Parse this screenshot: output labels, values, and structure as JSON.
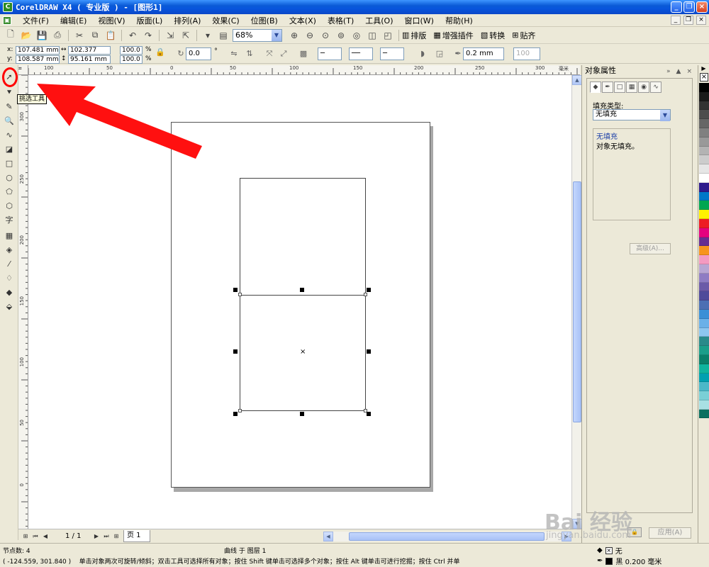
{
  "window": {
    "title": "CorelDRAW X4 ( 专业版 ) - [图形1]",
    "app_icon": "coreldraw-icon"
  },
  "menu": {
    "items": [
      "文件(F)",
      "编辑(E)",
      "视图(V)",
      "版面(L)",
      "排列(A)",
      "效果(C)",
      "位图(B)",
      "文本(X)",
      "表格(T)",
      "工具(O)",
      "窗口(W)",
      "帮助(H)"
    ]
  },
  "toolbar": {
    "zoom": "68%",
    "plugins": {
      "layout": "排版",
      "enhance": "增强插件",
      "convert": "转换",
      "snap": "贴齐"
    }
  },
  "propbar": {
    "x_label": "x:",
    "x": "107.481 mm",
    "y_label": "y:",
    "y": "108.587 mm",
    "w": "102.377 mm",
    "h": "95.161 mm",
    "scale_x": "100.0",
    "scale_y": "100.0",
    "pct": "%",
    "pct2": "%",
    "rotation": "0.0",
    "deg": "°",
    "outline_width": "0.2 mm",
    "miter": "100"
  },
  "ruler": {
    "top": [
      "100",
      "50",
      "0",
      "50",
      "100",
      "150",
      "200",
      "250",
      "300"
    ],
    "left": [
      "300",
      "250",
      "200",
      "150",
      "100",
      "50",
      "0"
    ],
    "unit": "毫米"
  },
  "tooltip": "挑选工具",
  "pager": {
    "count": "1 / 1",
    "tab": "页 1"
  },
  "docker": {
    "title": "对象属性",
    "fill_type_label": "填充类型:",
    "fill_type": "无填充",
    "info_title": "无填充",
    "info_text": "对象无填充。",
    "advanced": "高级(A)...",
    "apply": "应用(A)"
  },
  "palette": [
    "#000000",
    "#1a1a1a",
    "#333333",
    "#4d4d4d",
    "#666666",
    "#808080",
    "#999999",
    "#b3b3b3",
    "#cccccc",
    "#e6e6e6",
    "#ffffff",
    "#2e1a8c",
    "#0077c8",
    "#00a651",
    "#fff200",
    "#ed1c24",
    "#e4007f",
    "#662d91",
    "#f7941d",
    "#f49ac1",
    "#b7a6d3",
    "#8e7cc3",
    "#6b5aa8",
    "#4f4a9a",
    "#4c6fb3",
    "#3a8fd6",
    "#6ab0e8",
    "#8ec6ef",
    "#2a8a8a",
    "#1b9e8a",
    "#0a7f6a",
    "#0fb39e",
    "#00a0b0",
    "#4bb8c8",
    "#7acfd6",
    "#a8e0e4",
    "#0c6f5f"
  ],
  "status": {
    "nodes": "节点数: 4",
    "curve_layer": "曲线 于 图层 1",
    "coords": "( -124.559, 301.840 )",
    "hint": "单击对象两次可旋转/倾斜；双击工具可选择所有对象；按住 Shift 键单击可选择多个对象；按住 Alt 键单击可进行挖掘；按住 Ctrl 并单...",
    "fill_label": "无",
    "outline_label": "黑  0.200 毫米"
  },
  "watermark": {
    "brand": "Bai 经验",
    "url": "jingyan.baidu.com"
  }
}
